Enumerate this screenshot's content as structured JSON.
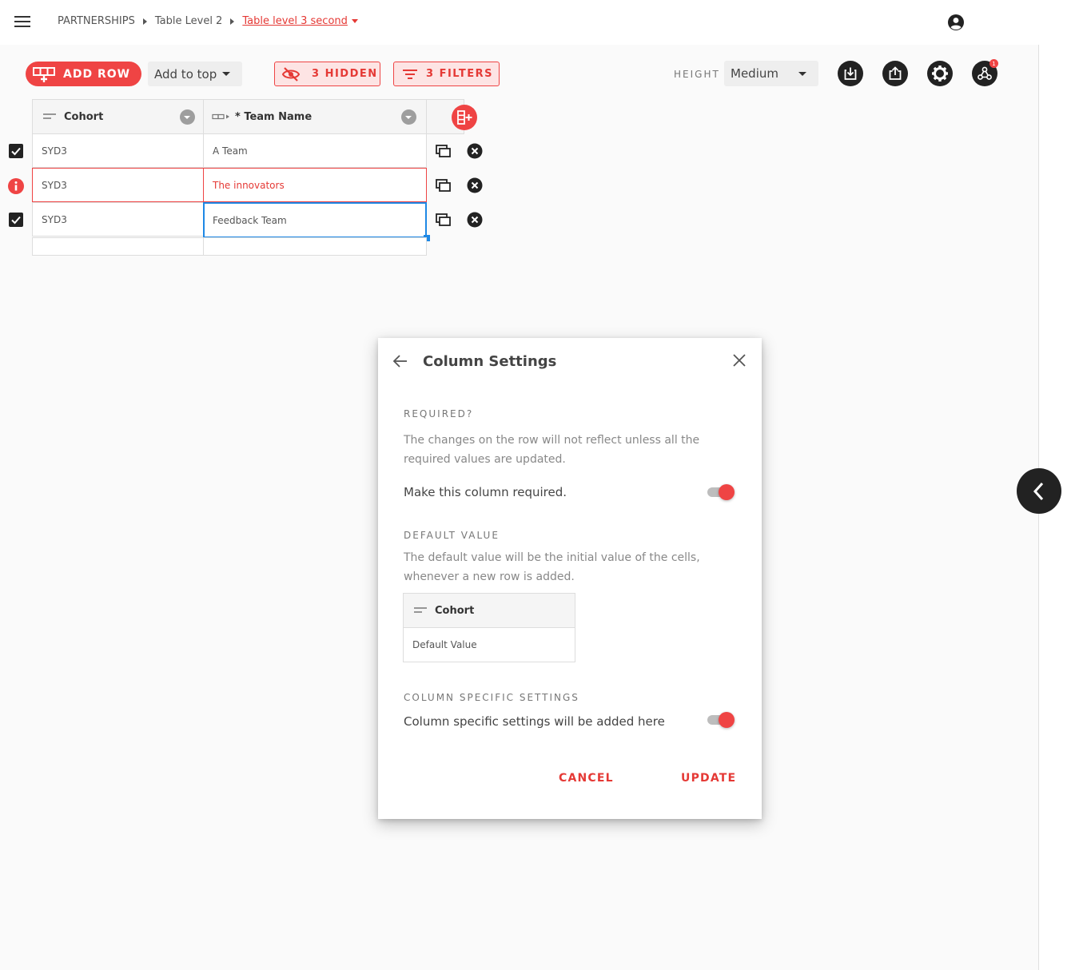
{
  "header": {
    "breadcrumb": [
      "PARTNERSHIPS",
      "Table Level 2",
      "Table level 3 second"
    ]
  },
  "toolbar": {
    "add_row_label": "ADD ROW",
    "add_position": "Add to top",
    "hidden_label": "3 HIDDEN",
    "filters_label": "3 FILTERS",
    "height_label": "HEIGHT",
    "height_value": "Medium",
    "notification_count": "1"
  },
  "table": {
    "columns": [
      {
        "label": "Cohort",
        "icon": "short-text-icon"
      },
      {
        "label": "* Team Name",
        "icon": "link-column-icon"
      }
    ],
    "rows": [
      {
        "cohort": "SYD3",
        "team": "A Team",
        "status": "selected"
      },
      {
        "cohort": "SYD3",
        "team": "The innovators",
        "status": "error"
      },
      {
        "cohort": "SYD3",
        "team": "Feedback Team",
        "status": "selected"
      }
    ]
  },
  "dialog": {
    "title": "Column Settings",
    "required": {
      "label": "REQUIRED?",
      "description": "The changes on the row will not reflect unless all the required values are updated.",
      "toggle_label": "Make this column required.",
      "enabled": true
    },
    "default_value": {
      "label": "DEFAULT VALUE",
      "description": "The default value will be the initial value of the cells, whenever a new row is added.",
      "column_label": "Cohort",
      "cell_value": "Default Value"
    },
    "column_specific": {
      "label": "COLUMN SPECIFIC SETTINGS",
      "toggle_label": "Column specific settings will be added here",
      "enabled": true
    },
    "cancel_label": "CANCEL",
    "update_label": "UPDATE"
  },
  "colors": {
    "accent": "#ef4444",
    "selection": "#1e88e5"
  }
}
